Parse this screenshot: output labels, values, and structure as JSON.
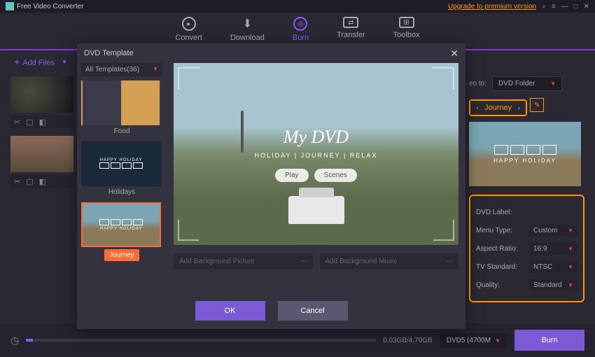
{
  "titlebar": {
    "title": "Free Video Converter",
    "upgrade": "Upgrade to premium version"
  },
  "tabs": {
    "convert": "Convert",
    "download": "Download",
    "burn": "Burn",
    "transfer": "Transfer",
    "toolbox": "Toolbox"
  },
  "toolbar": {
    "addfiles": "Add Files"
  },
  "right": {
    "burnto_label": "eo to:",
    "burnto_value": "DVD Folder",
    "journey": "Journey",
    "preview_title": "HAPPY HOLIDAY",
    "settings": {
      "dvdlabel": "DVD Label:",
      "menutype": "Menu Type:",
      "menutype_v": "Custom",
      "aspect": "Aspect Ratio:",
      "aspect_v": "16:9",
      "tvstd": "TV Standard:",
      "tvstd_v": "NTSC",
      "quality": "Quality:",
      "quality_v": "Standard"
    }
  },
  "modal": {
    "title": "DVD Template",
    "alltpl": "All Templates(36)",
    "templates": [
      {
        "name": "Food"
      },
      {
        "name": "Holidays"
      },
      {
        "name": "Journey"
      }
    ],
    "preview": {
      "title": "My DVD",
      "sub": "HOLIDAY | JOURNEY | RELAX",
      "play": "Play",
      "scenes": "Scenes"
    },
    "bgpic": "Add Background Picture",
    "bgmusic": "Add Background Music",
    "ok": "OK",
    "cancel": "Cancel",
    "thumb_title": "HAPPY HOLIDAY"
  },
  "bottom": {
    "size": "0.03GB/4.70GB",
    "disc": "DVD5 (4700M",
    "burn": "Burn"
  }
}
